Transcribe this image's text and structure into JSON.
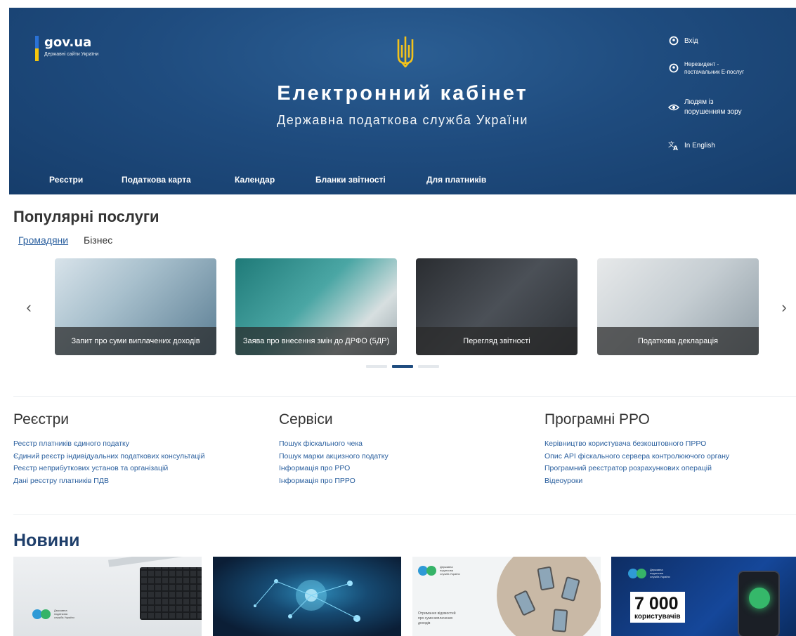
{
  "header": {
    "gov_name": "gov.ua",
    "gov_sub": "Державні сайти України",
    "title": "Електронний кабінет",
    "subtitle": "Державна податкова служба України"
  },
  "utility": {
    "login": "Вхід",
    "nonresident_line1": "Нерезидент -",
    "nonresident_line2": "постачальник E-послуг",
    "vision_line1": "Людям із",
    "vision_line2": "порушенням зору",
    "language": "In English"
  },
  "nav": {
    "items": [
      "Реєстри",
      "Податкова карта",
      "Календар",
      "Бланки звітності",
      "Для платників"
    ]
  },
  "popular": {
    "title": "Популярні послуги",
    "tab_citizens": "Громадяни",
    "tab_business": "Бізнес",
    "prev": "‹",
    "next": "›",
    "cards": [
      "Запит про суми виплачених доходів",
      "Заява про внесення змін до ДРФО (5ДР)",
      "Перегляд звітності",
      "Податкова декларація"
    ],
    "active_slide": 2,
    "total_slides": 3
  },
  "columns": [
    {
      "title": "Реєстри",
      "links": [
        "Реєстр платників єдиного податку",
        "Єдиний реєстр індивідуальних податкових консультацій",
        "Реєстр неприбуткових установ та організацій",
        "Дані реєстру платників ПДВ"
      ]
    },
    {
      "title": "Сервіси",
      "links": [
        "Пошук фіскального чека",
        "Пошук марки акцизного податку",
        "Інформація про РРО",
        "Інформація про ПРРО"
      ]
    },
    {
      "title": "Програмні РРО",
      "links": [
        "Керівництво користувача безкоштовного ПРРО",
        "Опис API фіскального сервера контролюючого органу",
        "Програмний реєстратор розрахункових операцій",
        "Відеоуроки"
      ]
    }
  ],
  "news": {
    "title": "Новини",
    "logo_text": "Державна податкова служба України",
    "card3_text": "Отримання відомостей про суми виплачених доходів",
    "card4_number": "7 000",
    "card4_unit": "користувачів"
  },
  "colors": {
    "header_bg": "#1f4c7f",
    "link": "#2a5f9e",
    "accent_yellow": "#f6c60b",
    "accent_blue": "#2a72d6"
  }
}
